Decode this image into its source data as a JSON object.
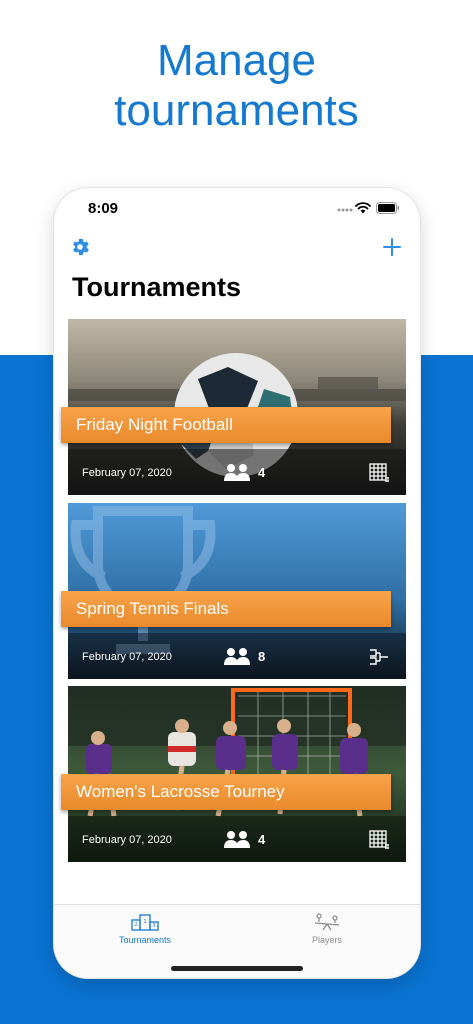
{
  "headline": "Manage\ntournaments",
  "status_bar": {
    "time": "8:09"
  },
  "header": {
    "title": "Tournaments",
    "settings_icon": "gear-icon",
    "add_icon": "plus-icon"
  },
  "tournaments": [
    {
      "name": "Friday Night Football",
      "date": "February 07, 2020",
      "players": "4",
      "format_icon": "grid-icon",
      "image": "soccer-ball-photo"
    },
    {
      "name": "Spring Tennis Finals",
      "date": "February 07, 2020",
      "players": "8",
      "format_icon": "bracket-icon",
      "image": "trophy-placeholder"
    },
    {
      "name": "Women's Lacrosse Tourney",
      "date": "February 07, 2020",
      "players": "4",
      "format_icon": "grid-icon",
      "image": "lacrosse-photo"
    }
  ],
  "tab_bar": {
    "tabs": [
      {
        "label": "Tournaments",
        "icon": "podium-icon",
        "active": true
      },
      {
        "label": "Players",
        "icon": "seesaw-icon",
        "active": false
      }
    ]
  },
  "colors": {
    "brand_blue": "#1479cf",
    "band_blue": "#0a73d1",
    "orange": "#ef922f",
    "ios_blue": "#2f8de4"
  }
}
